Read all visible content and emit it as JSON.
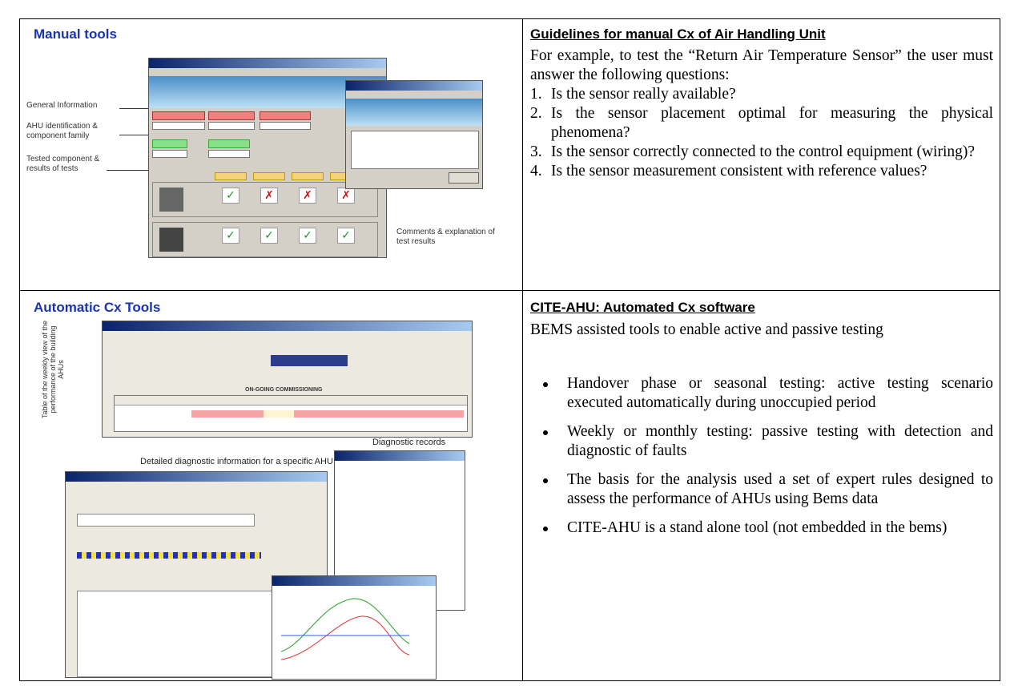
{
  "sections": {
    "manual_tools": {
      "title": "Manual tools",
      "annotations": {
        "general_info": "General Information",
        "ahu_identification": "AHU identification & component family",
        "tested_component": "Tested component & results of tests",
        "comments": "Comments & explanation of test results"
      }
    },
    "manual_guidelines": {
      "title": "Guidelines for manual Cx of Air Handling Unit",
      "intro": "For example, to test the “Return Air Temperature Sensor” the user must answer the following questions:",
      "questions": [
        {
          "num": "1.",
          "text": "Is the sensor really available?"
        },
        {
          "num": "2.",
          "text": "Is the sensor placement optimal for measuring the physical phenomena?"
        },
        {
          "num": "3.",
          "text": "Is the sensor correctly connected to the control equipment (wiring)?"
        },
        {
          "num": "4.",
          "text": "Is the sensor measurement consistent with reference values?"
        }
      ]
    },
    "automatic_tools": {
      "title": "Automatic Cx Tools",
      "annotations": {
        "table_view": "Table of the weekly view of the performance of the building AHUs",
        "diagnostic_records": "Diagnostic records",
        "detailed_info": "Detailed diagnostic information for a specific AHU"
      },
      "window_heading": "ON-GOING COMMISSIONING"
    },
    "cite_ahu": {
      "title": "CITE-AHU: Automated Cx software",
      "intro": "BEMS assisted tools to enable active and passive testing",
      "bullets": [
        "Handover phase or seasonal testing: active testing scenario executed automatically during unoccupied period",
        "Weekly or monthly testing: passive testing with detection and diagnostic of faults",
        "The basis for the analysis used a set of expert rules designed to assess the performance of AHUs using Bems data",
        "CITE-AHU is a stand alone tool (not embedded in the bems)"
      ]
    }
  },
  "colors": {
    "title_blue": "#1a33b0",
    "ok_green": "#1a9a1a",
    "fail_red": "#d01010"
  }
}
